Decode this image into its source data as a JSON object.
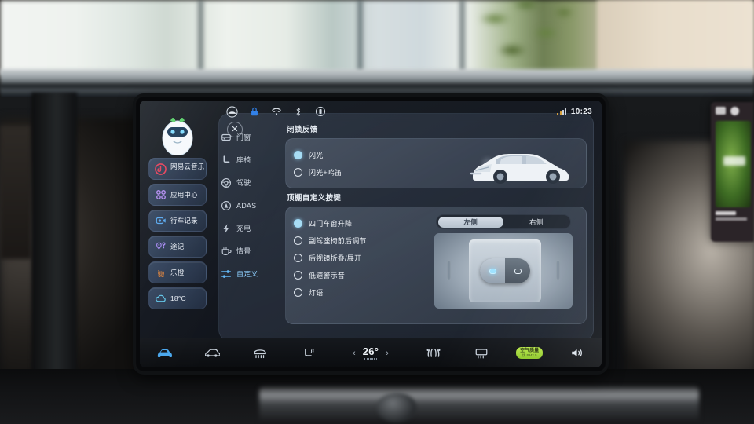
{
  "statusbar": {
    "icons": [
      "account-icon",
      "lock-icon",
      "wifi-icon",
      "bluetooth-icon",
      "phone-link-icon"
    ],
    "signal_label": "signal-bars",
    "clock": "10:23"
  },
  "dock": {
    "mascot": "robot-mascot",
    "items": [
      {
        "label": "网易云音乐",
        "sub": "···",
        "icon": "netease-music-icon",
        "color": "#e8415a"
      },
      {
        "label": "应用中心",
        "icon": "app-center-icon",
        "color": "#b28cf0"
      },
      {
        "label": "行车记录",
        "icon": "dashcam-icon",
        "color": "#5aa9ef"
      },
      {
        "label": "途记",
        "icon": "trip-log-icon",
        "color": "#a98cf5"
      },
      {
        "label": "乐橙",
        "icon": "imou-icon",
        "color": "#f08b3a"
      },
      {
        "label": "18°C",
        "icon": "cloud-weather-icon",
        "color": "#63c6e8"
      }
    ]
  },
  "menu": {
    "items": [
      {
        "label": "门窗",
        "icon": "door-window-icon",
        "active": false
      },
      {
        "label": "座椅",
        "icon": "seat-icon",
        "active": false
      },
      {
        "label": "驾驶",
        "icon": "steering-icon",
        "active": false
      },
      {
        "label": "ADAS",
        "icon": "adas-icon",
        "active": false
      },
      {
        "label": "充电",
        "icon": "charging-bolt-icon",
        "active": false
      },
      {
        "label": "情景",
        "icon": "scene-cup-icon",
        "active": false
      },
      {
        "label": "自定义",
        "icon": "customize-sliders-icon",
        "active": true
      }
    ]
  },
  "panel": {
    "close_label": "✕",
    "lock_feedback": {
      "title": "闭锁反馈",
      "options": [
        {
          "label": "闪光",
          "selected": true
        },
        {
          "label": "闪光+鸣笛",
          "selected": false
        }
      ],
      "car_image": "white-sedan-render"
    },
    "roof_button": {
      "title": "顶棚自定义按键",
      "options": [
        {
          "label": "四门车窗升降",
          "selected": true
        },
        {
          "label": "副驾座椅前后调节",
          "selected": false
        },
        {
          "label": "后视镜折叠/展开",
          "selected": false
        },
        {
          "label": "低速警示音",
          "selected": false
        },
        {
          "label": "灯语",
          "selected": false
        }
      ],
      "side_toggle": {
        "left": "左侧",
        "right": "右侧",
        "active": "左侧"
      },
      "illustration": "roof-console-switch"
    }
  },
  "climate": {
    "items": [
      {
        "icon": "car-front-icon",
        "active": true
      },
      {
        "icon": "hood-icon",
        "active": false
      },
      {
        "icon": "front-defrost-icon",
        "active": false
      },
      {
        "icon": "seat-heat-icon",
        "active": false
      }
    ],
    "temperature": "26°",
    "prev_label": "‹",
    "next_label": "›",
    "right_items": [
      {
        "icon": "airflow-icon"
      },
      {
        "icon": "rear-defrost-icon"
      }
    ],
    "aqi": {
      "top": "空气质量",
      "bottom": "优 PM2.5"
    },
    "volume_icon": "volume-icon"
  },
  "aux_screen": {
    "name": "passenger-display"
  },
  "colors": {
    "accent_blue": "#4aa8ef",
    "select_blue": "#a8dcf3",
    "aqi_green": "#9bd62e",
    "panel_bg": "#3c4758"
  }
}
